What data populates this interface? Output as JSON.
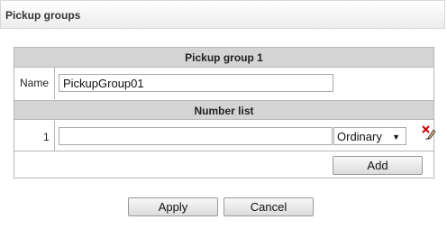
{
  "window": {
    "title": "Pickup groups"
  },
  "group": {
    "header": "Pickup group 1",
    "name_label": "Name",
    "name_value": "PickupGroup01"
  },
  "number_list": {
    "header": "Number list",
    "rows": [
      {
        "index": "1",
        "number": "",
        "type": "Ordinary"
      }
    ],
    "add_label": "Add"
  },
  "footer": {
    "apply_label": "Apply",
    "cancel_label": "Cancel"
  },
  "icons": {
    "row_action": "clear-edit-icon"
  }
}
